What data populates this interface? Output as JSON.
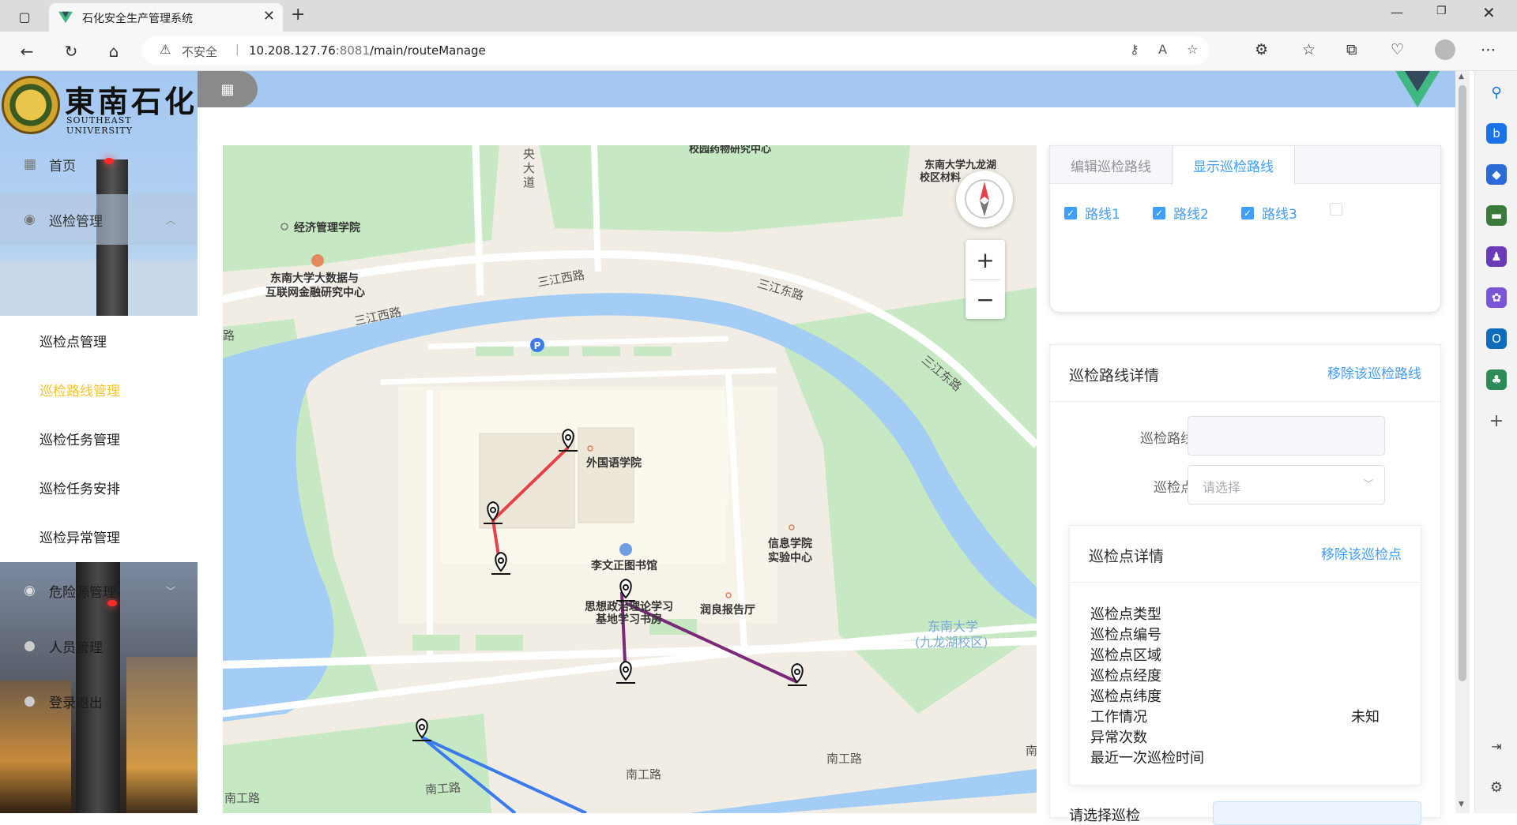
{
  "browser": {
    "tab_title": "石化安全生产管理系统",
    "insecure_label": "不安全",
    "url_host": "10.208.127.76",
    "url_port": ":8081",
    "url_path": "/main/routeManage"
  },
  "brand": {
    "name_cn": "東南石化",
    "name_en": "SOUTHEAST UNIVERSITY"
  },
  "menu": {
    "home": "首页",
    "inspection": "巡检管理",
    "sub_items": [
      "巡检点管理",
      "巡检路线管理",
      "巡检任务管理",
      "巡检任务安排",
      "巡检异常管理"
    ],
    "active_sub": "巡检路线管理",
    "hazard": "危险源管理",
    "personnel": "人员管理",
    "logout": "登录退出"
  },
  "map": {
    "labels": {
      "econ": "经济管理学院",
      "bigdata1": "东南大学大数据与",
      "bigdata2": "互联网金融研究中心",
      "sanjiang_west1": "三江西路",
      "sanjiang_west2": "三江西路",
      "sanjiang_east1": "三江东路",
      "sanjiang_east2": "三江东路",
      "central1": "央",
      "central2": "大",
      "central3": "道",
      "foreign": "外国语学院",
      "library": "李文正图书馆",
      "info1": "信息学院",
      "info2": "实验中心",
      "ideo1": "思想政治理论学习",
      "ideo2": "基地学习书房",
      "runliang": "润良报告厅",
      "campus1": "东南大学",
      "campus2": "(九龙湖校区)",
      "nangong1": "南工路",
      "nangong2": "南工路",
      "nangong3": "南工路",
      "nangong4": "南工路",
      "top_poi": "校园药物研究中心",
      "top_right1": "东南大学九龙湖",
      "top_right2": "校区材料",
      "road_left": "路",
      "south_right": "南"
    },
    "route_colors": {
      "route1": "#e8404a",
      "route2": "#7b2a7a",
      "route3": "#3b7bef"
    },
    "zoom_in": "+",
    "zoom_out": "−"
  },
  "route_panel": {
    "tabs": [
      "编辑巡检路线",
      "显示巡检路线"
    ],
    "active_tab": "显示巡检路线",
    "routes": [
      {
        "label": "路线1",
        "checked": true
      },
      {
        "label": "路线2",
        "checked": true
      },
      {
        "label": "路线3",
        "checked": true
      },
      {
        "label": "",
        "checked": false
      }
    ]
  },
  "detail": {
    "title": "巡检路线详情",
    "remove_route": "移除该巡检路线",
    "name_label": "巡检路线名称",
    "name_value": "",
    "point_label": "巡检点编号",
    "point_placeholder": "请选择"
  },
  "point": {
    "title": "巡检点详情",
    "remove_point": "移除该巡检点",
    "rows": [
      "巡检点类型",
      "巡检点编号",
      "巡检点区域",
      "巡检点经度",
      "巡检点纬度",
      "工作情况",
      "异常次数",
      "最近一次巡检时间"
    ],
    "work_status": "未知"
  },
  "footer_partial": "请选择巡检"
}
